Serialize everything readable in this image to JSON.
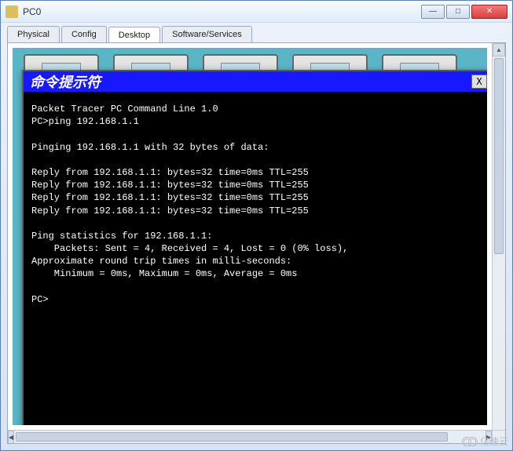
{
  "window": {
    "title": "PC0",
    "buttons": {
      "min": "—",
      "max": "□",
      "close": "✕"
    }
  },
  "tabs": {
    "physical": "Physical",
    "config": "Config",
    "desktop": "Desktop",
    "software": "Software/Services"
  },
  "cmd": {
    "title": "命令提示符",
    "close": "X",
    "lines": [
      "Packet Tracer PC Command Line 1.0",
      "PC>ping 192.168.1.1",
      "",
      "Pinging 192.168.1.1 with 32 bytes of data:",
      "",
      "Reply from 192.168.1.1: bytes=32 time=0ms TTL=255",
      "Reply from 192.168.1.1: bytes=32 time=0ms TTL=255",
      "Reply from 192.168.1.1: bytes=32 time=0ms TTL=255",
      "Reply from 192.168.1.1: bytes=32 time=0ms TTL=255",
      "",
      "Ping statistics for 192.168.1.1:",
      "    Packets: Sent = 4, Received = 4, Lost = 0 (0% loss),",
      "Approximate round trip times in milli-seconds:",
      "    Minimum = 0ms, Maximum = 0ms, Average = 0ms",
      "",
      "PC>"
    ]
  },
  "scroll": {
    "up": "▲",
    "down": "▼",
    "left": "◀",
    "right": "▶"
  },
  "watermark": "亿速云"
}
